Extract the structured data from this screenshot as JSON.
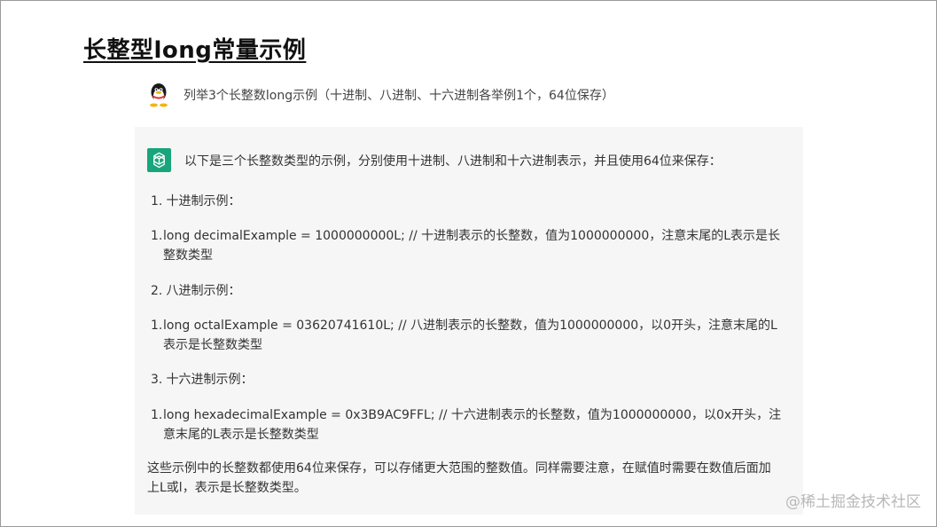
{
  "title": "长整型long常量示例",
  "user_message": "列举3个长整数long示例（十进制、八进制、十六进制各举例1个，64位保存）",
  "answer": {
    "intro": "以下是三个长整数类型的示例，分别使用十进制、八进制和十六进制表示，并且使用64位来保存：",
    "sections": [
      {
        "number": "1.",
        "heading": "十进制示例：",
        "code_number": "1.",
        "code": "long decimalExample = 1000000000L; // 十进制表示的长整数，值为1000000000，注意末尾的L表示是长整数类型"
      },
      {
        "number": "2.",
        "heading": "八进制示例：",
        "code_number": "1.",
        "code": "long octalExample = 03620741610L; // 八进制表示的长整数，值为1000000000，以0开头，注意末尾的L表示是长整数类型"
      },
      {
        "number": "3.",
        "heading": "十六进制示例：",
        "code_number": "1.",
        "code": "long hexadecimalExample = 0x3B9AC9FFL; // 十六进制表示的长整数，值为1000000000，以0x开头，注意末尾的L表示是长整数类型"
      }
    ],
    "summary": "这些示例中的长整数都使用64位来保存，可以存储更大范围的整数值。同样需要注意，在赋值时需要在数值后面加上L或l，表示是长整数类型。"
  },
  "watermark": "@稀土掘金技术社区",
  "colors": {
    "gpt_avatar": "#19a57c",
    "answer_bg": "#f6f6f6"
  },
  "icons": {
    "user_avatar": "qq-penguin-icon",
    "assistant_avatar": "openai-logo-icon"
  }
}
